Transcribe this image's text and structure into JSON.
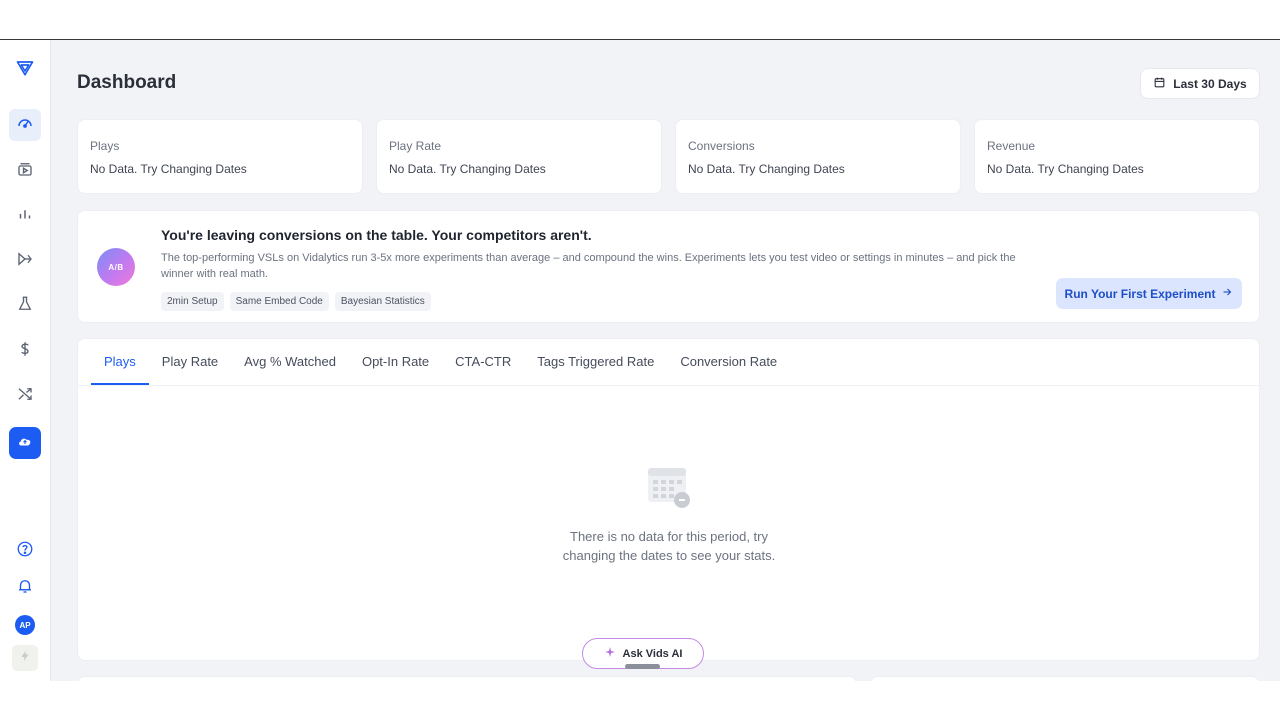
{
  "page": {
    "title": "Dashboard",
    "date_range": "Last 30 Days"
  },
  "stats": [
    {
      "label": "Plays",
      "value": "No Data. Try Changing Dates"
    },
    {
      "label": "Play Rate",
      "value": "No Data. Try Changing Dates"
    },
    {
      "label": "Conversions",
      "value": "No Data. Try Changing Dates"
    },
    {
      "label": "Revenue",
      "value": "No Data. Try Changing Dates"
    }
  ],
  "promo": {
    "badge": "A/B",
    "headline": "You're leaving conversions on the table. Your competitors aren't.",
    "body": "The top-performing VSLs on Vidalytics run 3-5x more experiments than average – and compound the wins. Experiments lets you test video or settings in minutes – and pick the winner with real math.",
    "tags": [
      "2min Setup",
      "Same Embed Code",
      "Bayesian Statistics"
    ],
    "cta": "Run Your First Experiment"
  },
  "tabs": [
    "Plays",
    "Play Rate",
    "Avg % Watched",
    "Opt-In Rate",
    "CTA-CTR",
    "Tags Triggered Rate",
    "Conversion Rate"
  ],
  "active_tab": "Plays",
  "empty_state": {
    "line1": "There is no data for this period, try",
    "line2": "changing the dates to see your stats."
  },
  "assistant": {
    "label": "Ask Vids AI"
  },
  "user": {
    "initials": "AP"
  },
  "sidebar": {
    "icons": [
      "logo-icon",
      "dashboard-icon",
      "videos-icon",
      "analytics-icon",
      "funnel-icon",
      "experiments-icon",
      "revenue-icon",
      "integrations-icon",
      "upload-icon",
      "help-icon",
      "bell-icon",
      "bolt-icon"
    ]
  },
  "colors": {
    "accent": "#1d5cf2",
    "background": "#f2f3f6",
    "card": "#ffffff",
    "cta_bg": "#dbe5fd"
  }
}
